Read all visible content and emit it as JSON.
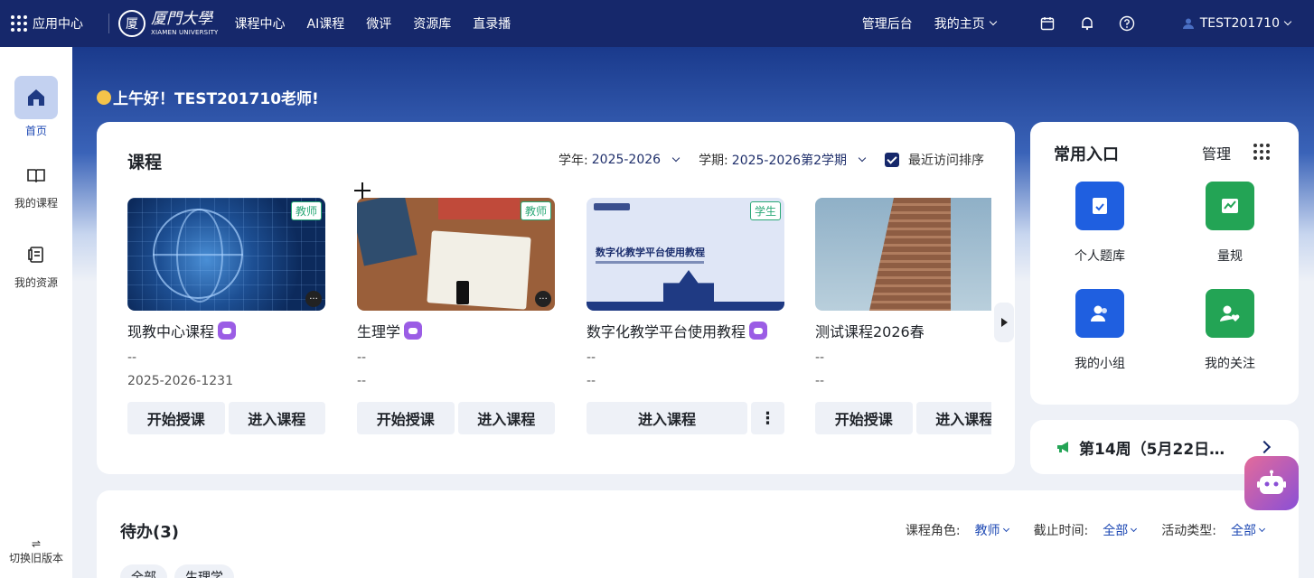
{
  "topbar": {
    "app_center": "应用中心",
    "logo_cn": "厦門大學",
    "logo_en": "XIAMEN UNIVERSITY",
    "logo_seal": "厦",
    "nav": [
      "课程中心",
      "AI课程",
      "微评",
      "资源库",
      "直录播"
    ],
    "admin": "管理后台",
    "my_home": "我的主页",
    "username": "TEST201710"
  },
  "sidebar": {
    "items": [
      {
        "label": "首页",
        "icon": "home-icon",
        "active": true
      },
      {
        "label": "我的课程",
        "icon": "book-icon"
      },
      {
        "label": "我的资源",
        "icon": "resource-icon"
      }
    ],
    "switch_old": "切换旧版本",
    "switch_icon": "⇌"
  },
  "greeting": "上午好！TEST201710老师!",
  "courses": {
    "title": "课程",
    "year_label": "学年:",
    "year_value": "2025-2026",
    "term_label": "学期:",
    "term_value": "2025-2026第2学期",
    "sort_label": "最近访问排序",
    "sort_checked": true,
    "items": [
      {
        "name": "现教中心课程",
        "role": "教师",
        "meta1": "--",
        "meta2": "2025-2026-1231",
        "btn_start": "开始授课",
        "btn_enter": "进入课程",
        "ai": true,
        "more_dot": "···"
      },
      {
        "name": "生理学",
        "role": "教师",
        "meta1": "--",
        "meta2": "--",
        "btn_start": "开始授课",
        "btn_enter": "进入课程",
        "ai": true,
        "more_dot": "···"
      },
      {
        "name": "数字化教学平台使用教程",
        "role": "学生",
        "meta1": "--",
        "meta2": "--",
        "btn_enter": "进入课程",
        "btn_more": "⋮",
        "ai": true,
        "thumb_title": "数字化教学平台使用教程"
      },
      {
        "name": "测试课程2026春",
        "role": "教师",
        "meta1": "--",
        "meta2": "--",
        "btn_start": "开始授课",
        "btn_enter": "进入课程",
        "ai": false
      }
    ]
  },
  "quick": {
    "title": "常用入口",
    "manage": "管理",
    "items": [
      {
        "label": "个人题库",
        "color": "#1f5fe0",
        "icon": "question-bank-icon"
      },
      {
        "label": "量规",
        "color": "#23a455",
        "icon": "rubric-chart-icon"
      },
      {
        "label": "我的小组",
        "color": "#1f5fe0",
        "icon": "group-icon"
      },
      {
        "label": "我的关注",
        "color": "#23a455",
        "icon": "follow-heart-icon"
      }
    ]
  },
  "week": {
    "text": "第14周（5月22日…"
  },
  "todo": {
    "title": "待办(3)",
    "role_label": "课程角色:",
    "role_value": "教师",
    "deadline_label": "截止时间:",
    "deadline_value": "全部",
    "type_label": "活动类型:",
    "type_value": "全部",
    "chips": [
      "全部",
      "生理学"
    ]
  },
  "colors": {
    "navy": "#16286b",
    "accent_blue": "#1f4ab4",
    "green": "#23a455",
    "blue": "#1f5fe0",
    "role_green": "#2aa876"
  }
}
